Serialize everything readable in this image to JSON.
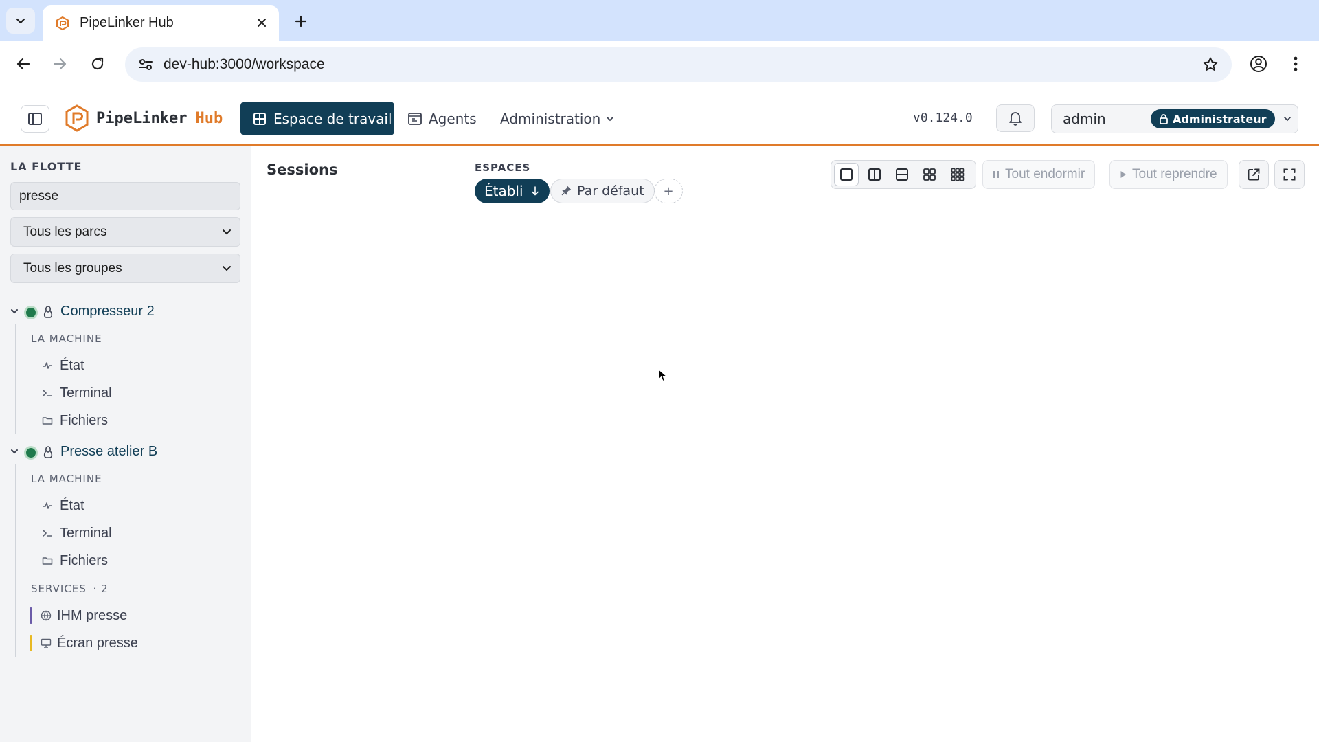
{
  "browser": {
    "tab_title": "PipeLinker Hub",
    "url": "dev-hub:3000/workspace"
  },
  "header": {
    "brand_name": "PipeLinker",
    "brand_sub": "Hub",
    "nav": {
      "workspace": "Espace de travail",
      "agents": "Agents",
      "admin": "Administration"
    },
    "version": "v0.124.0",
    "user": "admin",
    "role": "Administrateur",
    "accent_color": "#e07b2a",
    "primary_color": "#113e56"
  },
  "sidebar": {
    "heading": "LA FLOTTE",
    "search_value": "presse",
    "park_select": "Tous les parcs",
    "group_select": "Tous les groupes",
    "machines": [
      {
        "name": "Compresseur 2",
        "section": "LA MACHINE",
        "items": [
          "État",
          "Terminal",
          "Fichiers"
        ]
      },
      {
        "name": "Presse atelier B",
        "section": "LA MACHINE",
        "items": [
          "État",
          "Terminal",
          "Fichiers"
        ],
        "services_label": "SERVICES",
        "services_count": "· 2",
        "services": [
          {
            "name": "IHM presse",
            "color": "#6b5ba8",
            "icon": "globe-icon"
          },
          {
            "name": "Écran presse",
            "color": "#e8b923",
            "icon": "monitor-icon"
          }
        ]
      }
    ]
  },
  "main": {
    "title": "Sessions",
    "spaces_label": "ESPACES",
    "spaces": [
      "Établi",
      "Par défaut"
    ],
    "add_space": "+",
    "sleep_all": "Tout endormir",
    "resume_all": "Tout reprendre"
  }
}
